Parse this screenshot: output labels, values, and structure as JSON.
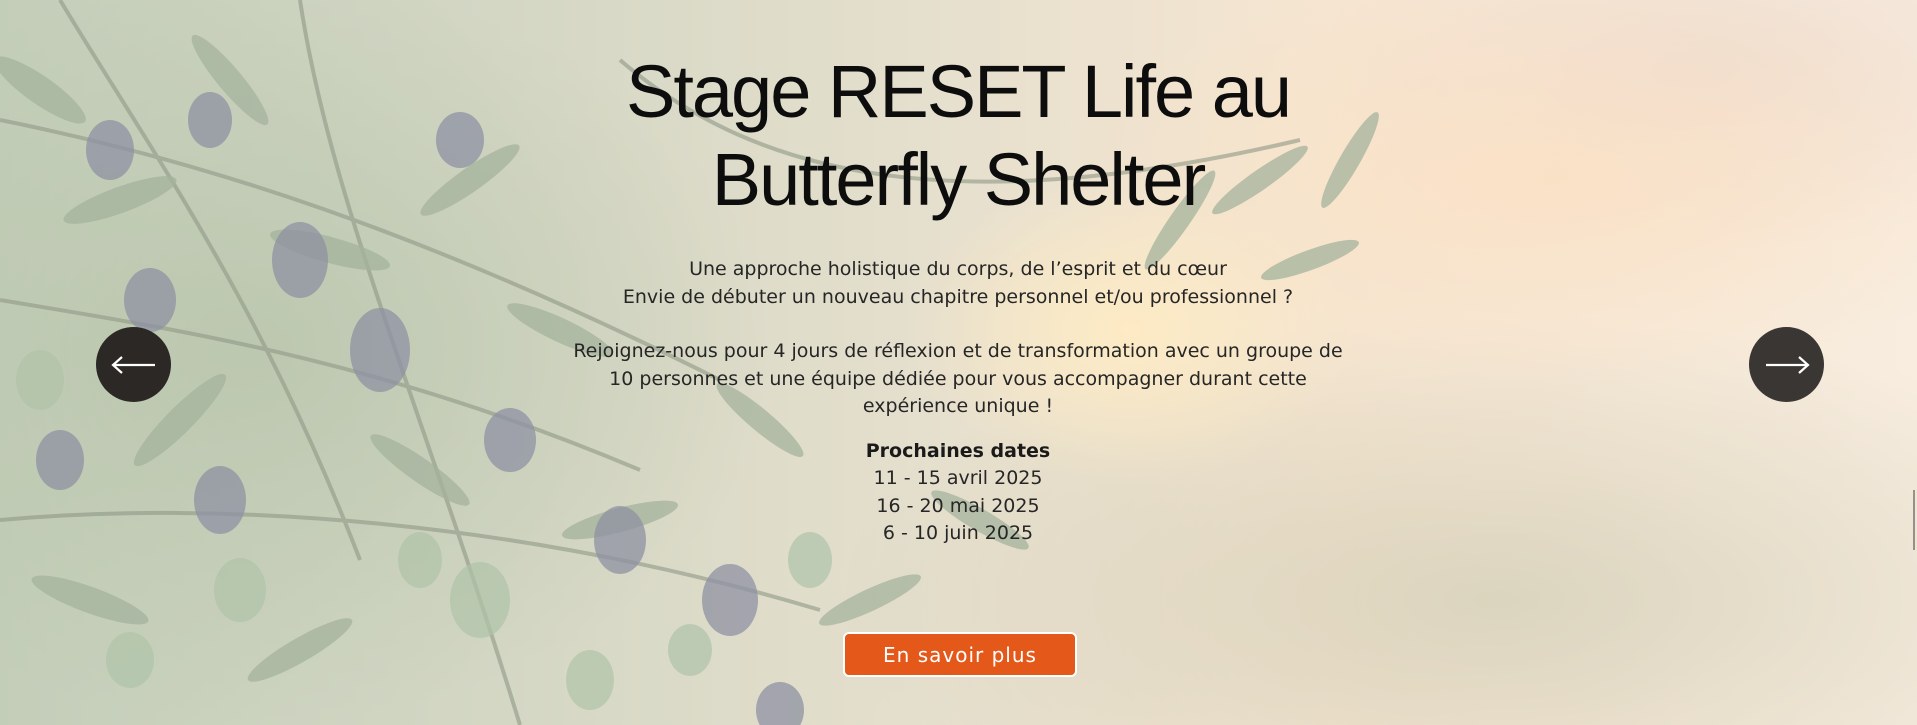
{
  "hero": {
    "title_line1": "Stage RESET Life au",
    "title_line2": "Butterfly Shelter",
    "intro_line1": "Une approche holistique du corps, de l’esprit et du cœur",
    "intro_line2": "Envie de débuter un nouveau chapitre personnel et/ou professionnel ?",
    "invite_line1": "Rejoignez-nous pour 4 jours de réflexion et de transformation avec un groupe de",
    "invite_line2": "10 personnes et une équipe dédiée pour vous accompagner durant cette",
    "invite_line3": "expérience unique !",
    "dates_title": "Prochaines dates",
    "dates": [
      "11 - 15 avril 2025",
      "16 - 20 mai 2025",
      "6 - 10 juin 2025"
    ],
    "cta_label": "En savoir plus"
  },
  "carousel": {
    "prev_icon": "arrow-left-icon",
    "next_icon": "arrow-right-icon"
  },
  "colors": {
    "cta": "#e4581a",
    "nav_button": "#2b2826",
    "title": "#0d0d0d"
  }
}
